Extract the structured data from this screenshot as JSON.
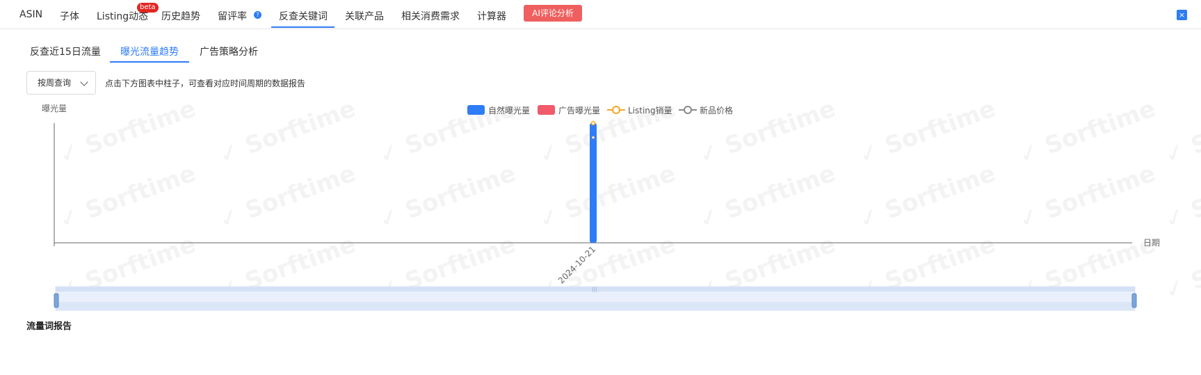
{
  "topnav": {
    "tabs": [
      "ASIN",
      "子体",
      "Listing动态",
      "历史趋势",
      "留评率",
      "反查关键词",
      "关联产品",
      "相关消费需求",
      "计算器"
    ],
    "beta_badge": "beta",
    "help_icon_glyph": "?",
    "ai_button": "AI评论分析",
    "close_glyph": "×",
    "accent_color": "#2e7cf6"
  },
  "subtabs": [
    "反查近15日流量",
    "曝光流量趋势",
    "广告策略分析"
  ],
  "filter": {
    "select_value": "按周查询",
    "hint": "点击下方图表中柱子，可查看对应时间周期的数据报告"
  },
  "watermark_text": "Sorftime",
  "chart_data": {
    "type": "bar",
    "ylabel": "曝光量",
    "xlabel": "日期",
    "categories": [
      "2024-10-21"
    ],
    "series": [
      {
        "name": "自然曝光量",
        "type": "bar",
        "color": "#2e7cf6",
        "values": [
          1
        ]
      },
      {
        "name": "广告曝光量",
        "type": "bar",
        "color": "#f05a6a",
        "values": [
          0
        ]
      },
      {
        "name": "Listing销量",
        "type": "line",
        "color": "#f5a623",
        "values": [
          1
        ]
      },
      {
        "name": "新品价格",
        "type": "line",
        "color": "#888888",
        "values": [
          0.88
        ]
      }
    ],
    "legend_position": "top-center",
    "grid": false,
    "datazoom": true
  },
  "report": {
    "title": "流量词报告"
  }
}
